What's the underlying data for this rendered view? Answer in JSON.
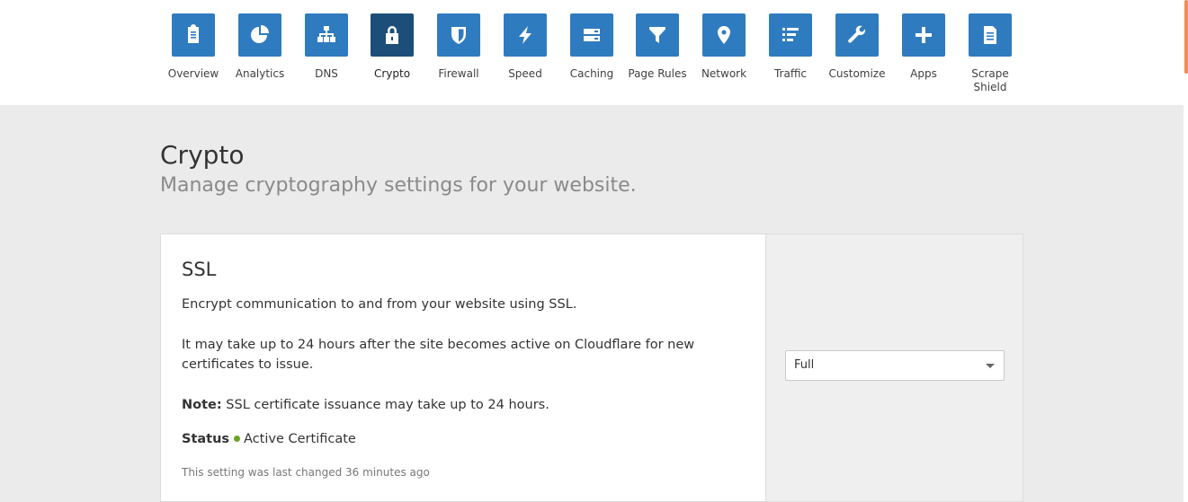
{
  "nav": [
    {
      "label": "Overview",
      "icon": "clipboard-icon"
    },
    {
      "label": "Analytics",
      "icon": "pie-chart-icon"
    },
    {
      "label": "DNS",
      "icon": "network-tree-icon"
    },
    {
      "label": "Crypto",
      "icon": "lock-icon",
      "active": true
    },
    {
      "label": "Firewall",
      "icon": "shield-icon"
    },
    {
      "label": "Speed",
      "icon": "lightning-icon"
    },
    {
      "label": "Caching",
      "icon": "server-icon"
    },
    {
      "label": "Page Rules",
      "icon": "filter-icon"
    },
    {
      "label": "Network",
      "icon": "location-pin-icon"
    },
    {
      "label": "Traffic",
      "icon": "list-icon"
    },
    {
      "label": "Customize",
      "icon": "wrench-icon"
    },
    {
      "label": "Apps",
      "icon": "plus-icon"
    },
    {
      "label": "Scrape Shield",
      "icon": "document-icon"
    }
  ],
  "page": {
    "title": "Crypto",
    "subtitle": "Manage cryptography settings for your website."
  },
  "ssl_card": {
    "title": "SSL",
    "description": "Encrypt communication to and from your website using SSL.",
    "propagation_note": "It may take up to 24 hours after the site becomes active on Cloudflare for new certificates to issue.",
    "note_label": "Note:",
    "note_text": " SSL certificate issuance may take up to 24 hours.",
    "status_label": "Status",
    "status_value": "Active Certificate",
    "last_changed": "This setting was last changed 36 minutes ago",
    "mode_selected": "Full"
  },
  "colors": {
    "tile": "#2f7bbf",
    "tile_active": "#1d4e79",
    "status_ok": "#6aa425",
    "accent_scroll": "#f28c59"
  }
}
